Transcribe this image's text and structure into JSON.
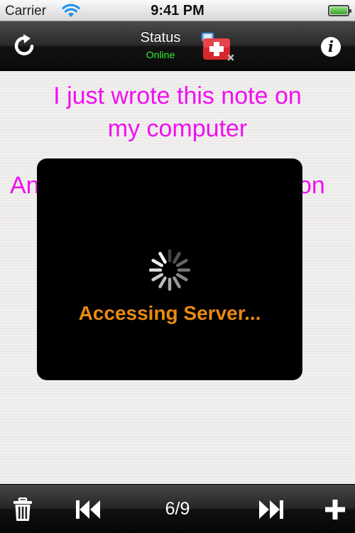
{
  "statusbar": {
    "carrier": "Carrier",
    "time": "9:41 PM",
    "wifi_icon": "wifi-icon",
    "battery_icon": "battery-icon",
    "battery_level": 1.0
  },
  "navbar": {
    "refresh_icon": "refresh-icon",
    "title": "Status",
    "status": "Online",
    "status_color": "#2ef02e",
    "app_icon": "app-icon",
    "info_icon": "info-icon",
    "info_glyph": "i"
  },
  "note": {
    "lines": [
      "I just wrote this note on",
      "my computer"
    ],
    "partial_left": "An",
    "partial_right": "on",
    "text_color": "#f010f0"
  },
  "hud": {
    "message": "Accessing Server...",
    "message_color": "#e88a12",
    "spinner_icon": "spinner-icon"
  },
  "toolbar": {
    "trash_icon": "trash-icon",
    "prev_icon": "skip-back-icon",
    "counter": "6/9",
    "next_icon": "skip-forward-icon",
    "add_icon": "plus-icon"
  }
}
